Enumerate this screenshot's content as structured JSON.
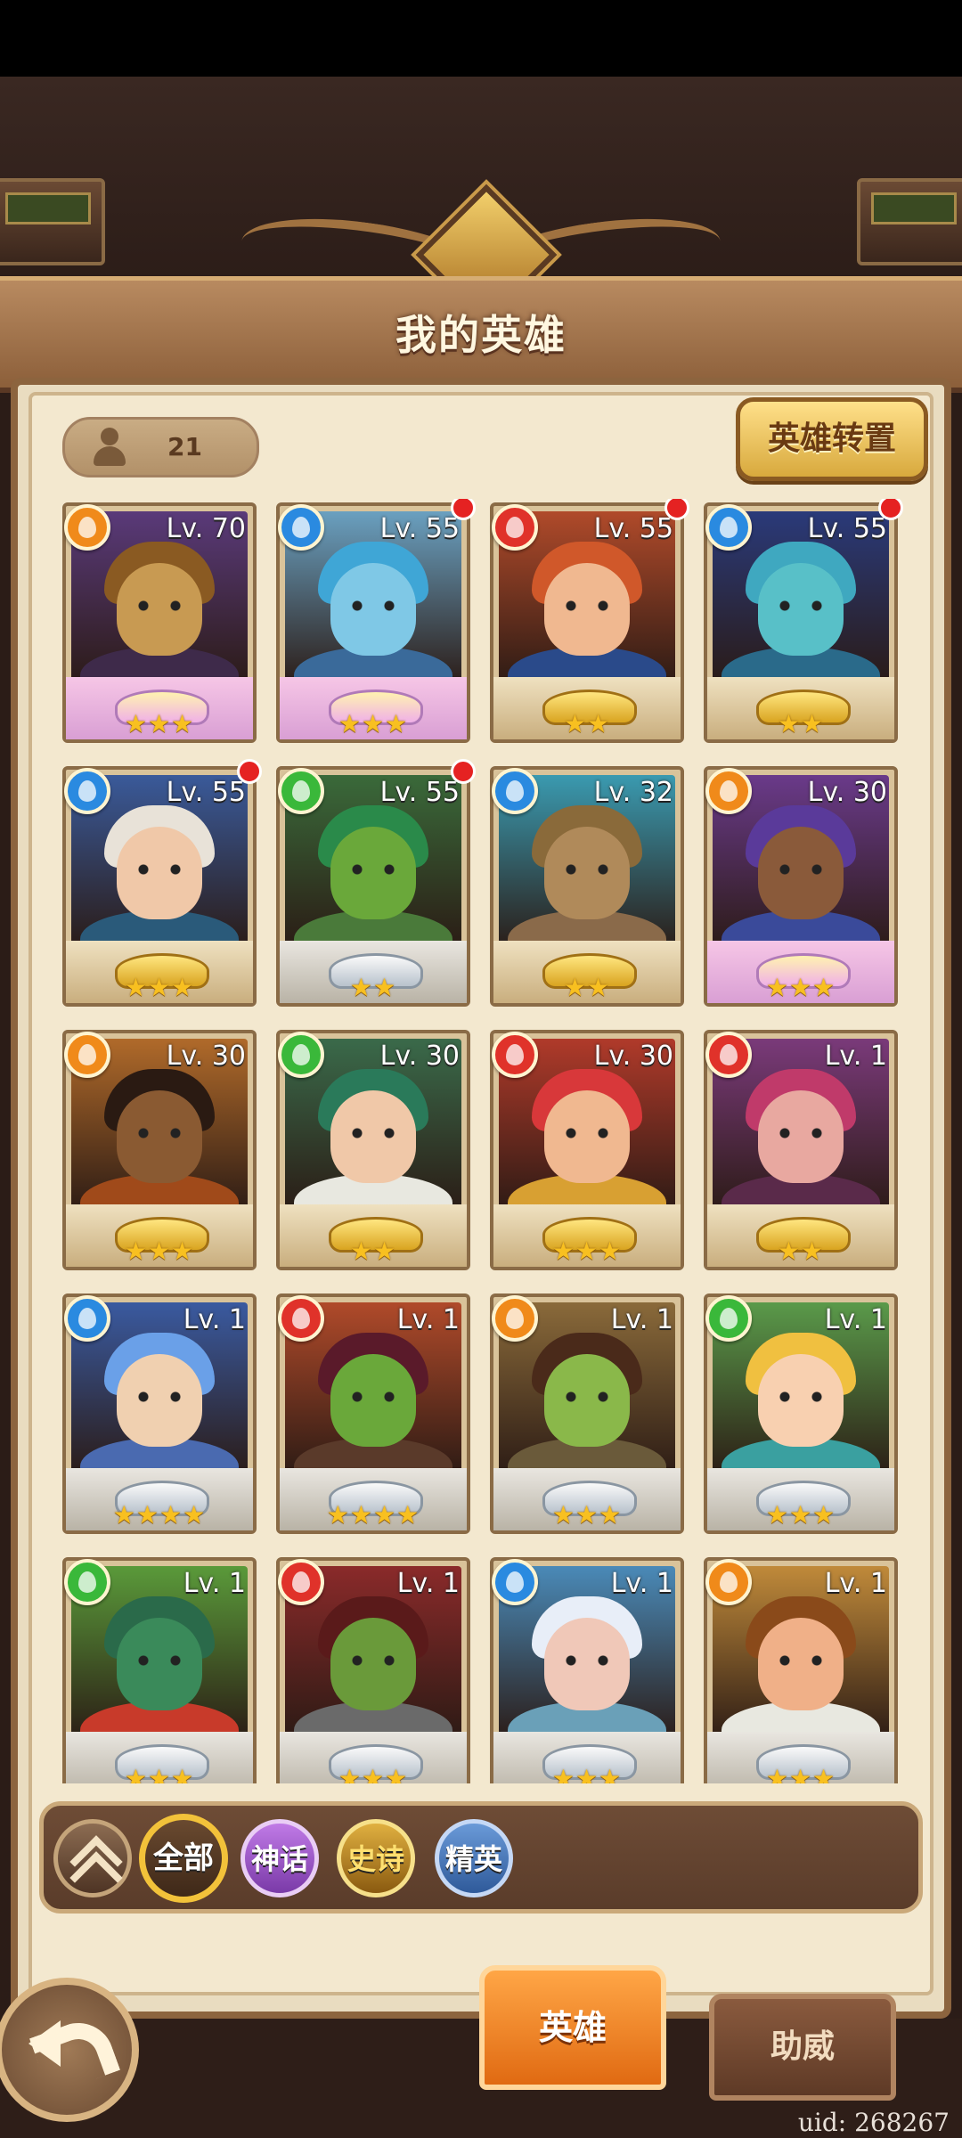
{
  "header": {
    "title": "我的英雄"
  },
  "hero_count": "21",
  "transfer_button": "英雄转置",
  "heroes": [
    {
      "level": "Lv. 70",
      "element": "earth",
      "stars": "★★★",
      "frame": "legend",
      "dot": false,
      "hair": "#8a5a22",
      "skin": "#c89a52",
      "bg": "#5a3a7a",
      "shoulder": "#3e2a4a"
    },
    {
      "level": "Lv. 55",
      "element": "water",
      "stars": "★★★",
      "frame": "legend",
      "dot": true,
      "hair": "#3fa6d6",
      "skin": "#7fc8e6",
      "bg": "#6aa0c0",
      "shoulder": "#3a6a9a"
    },
    {
      "level": "Lv. 55",
      "element": "fire",
      "stars": "★★",
      "frame": "gold",
      "dot": true,
      "hair": "#d0582a",
      "skin": "#f0b890",
      "bg": "#b04a2a",
      "shoulder": "#2a4a8a"
    },
    {
      "level": "Lv. 55",
      "element": "water",
      "stars": "★★",
      "frame": "gold",
      "dot": true,
      "hair": "#3fa8c0",
      "skin": "#58c0c8",
      "bg": "#2a3a7a",
      "shoulder": "#2a6a8a"
    },
    {
      "level": "Lv. 55",
      "element": "water",
      "stars": "★★★",
      "frame": "gold",
      "dot": true,
      "hair": "#e8e2d8",
      "skin": "#f0c8a8",
      "bg": "#3a5a9a",
      "shoulder": "#2a5a7a"
    },
    {
      "level": "Lv. 55",
      "element": "nature",
      "stars": "★★",
      "frame": "silver",
      "dot": true,
      "hair": "#2a8a4a",
      "skin": "#6aa83a",
      "bg": "#3a6a3a",
      "shoulder": "#4a7a3a"
    },
    {
      "level": "Lv. 32",
      "element": "water",
      "stars": "★★",
      "frame": "gold",
      "dot": false,
      "hair": "#8a6a3a",
      "skin": "#b08a5a",
      "bg": "#3a9ab0",
      "shoulder": "#8a6a4a"
    },
    {
      "level": "Lv. 30",
      "element": "earth",
      "stars": "★★★",
      "frame": "legend",
      "dot": false,
      "hair": "#5a3a9a",
      "skin": "#8a5a3a",
      "bg": "#6a3a8a",
      "shoulder": "#3a4a9a"
    },
    {
      "level": "Lv. 30",
      "element": "earth",
      "stars": "★★★",
      "frame": "gold",
      "dot": false,
      "hair": "#2a1a12",
      "skin": "#8a5a32",
      "bg": "#b06a2a",
      "shoulder": "#a04a1a"
    },
    {
      "level": "Lv. 30",
      "element": "nature",
      "stars": "★★",
      "frame": "gold",
      "dot": false,
      "hair": "#2a7a5a",
      "skin": "#f0c8a8",
      "bg": "#3a6a4a",
      "shoulder": "#e8e8e0"
    },
    {
      "level": "Lv. 30",
      "element": "fire",
      "stars": "★★★",
      "frame": "gold",
      "dot": false,
      "hair": "#d8383a",
      "skin": "#f0b890",
      "bg": "#b03a2a",
      "shoulder": "#d8a032"
    },
    {
      "level": "Lv. 1",
      "element": "fire",
      "stars": "★★",
      "frame": "gold",
      "dot": false,
      "hair": "#c03a6a",
      "skin": "#e8a8a0",
      "bg": "#7a3a7a",
      "shoulder": "#5a2a4a"
    },
    {
      "level": "Lv. 1",
      "element": "water",
      "stars": "★★★★",
      "frame": "silver",
      "dot": false,
      "hair": "#6aa0e8",
      "skin": "#f0d0b0",
      "bg": "#3a5aa0",
      "shoulder": "#4a6ab0"
    },
    {
      "level": "Lv. 1",
      "element": "fire",
      "stars": "★★★★",
      "frame": "silver",
      "dot": false,
      "hair": "#5a1a2a",
      "skin": "#6aa83a",
      "bg": "#b04a2a",
      "shoulder": "#5a3a2a"
    },
    {
      "level": "Lv. 1",
      "element": "earth",
      "stars": "★★★",
      "frame": "silver",
      "dot": false,
      "hair": "#4a2a1a",
      "skin": "#8ab84a",
      "bg": "#8a6a3a",
      "shoulder": "#6a5a3a"
    },
    {
      "level": "Lv. 1",
      "element": "nature",
      "stars": "★★★",
      "frame": "silver",
      "dot": false,
      "hair": "#f0c040",
      "skin": "#f8d0b0",
      "bg": "#5a9a4a",
      "shoulder": "#3aa0a0"
    },
    {
      "level": "Lv. 1",
      "element": "nature",
      "stars": "★★★",
      "frame": "silver",
      "dot": false,
      "hair": "#2a6a4a",
      "skin": "#3a8a5a",
      "bg": "#5a9a3a",
      "shoulder": "#c83a2a"
    },
    {
      "level": "Lv. 1",
      "element": "fire",
      "stars": "★★★",
      "frame": "silver",
      "dot": false,
      "hair": "#5a1a1a",
      "skin": "#6a9a3a",
      "bg": "#8a2a2a",
      "shoulder": "#6a6a6a"
    },
    {
      "level": "Lv. 1",
      "element": "water",
      "stars": "★★★",
      "frame": "silver",
      "dot": false,
      "hair": "#e8eef8",
      "skin": "#f0c8b8",
      "bg": "#4a8ab8",
      "shoulder": "#6aa0b8"
    },
    {
      "level": "Lv. 1",
      "element": "earth",
      "stars": "★★★",
      "frame": "silver",
      "dot": false,
      "hair": "#8a4a1a",
      "skin": "#f0b088",
      "bg": "#c08a3a",
      "shoulder": "#e8e8e0"
    }
  ],
  "element_colors": {
    "fire": "#e0322a",
    "water": "#2a8ae0",
    "earth": "#f08a1a",
    "nature": "#3ab83a"
  },
  "filters": {
    "all": "全部",
    "myth": "神话",
    "epic": "史诗",
    "elite": "精英"
  },
  "tabs": {
    "hero": "英雄",
    "assist": "助威"
  },
  "uid": "uid: 268267"
}
